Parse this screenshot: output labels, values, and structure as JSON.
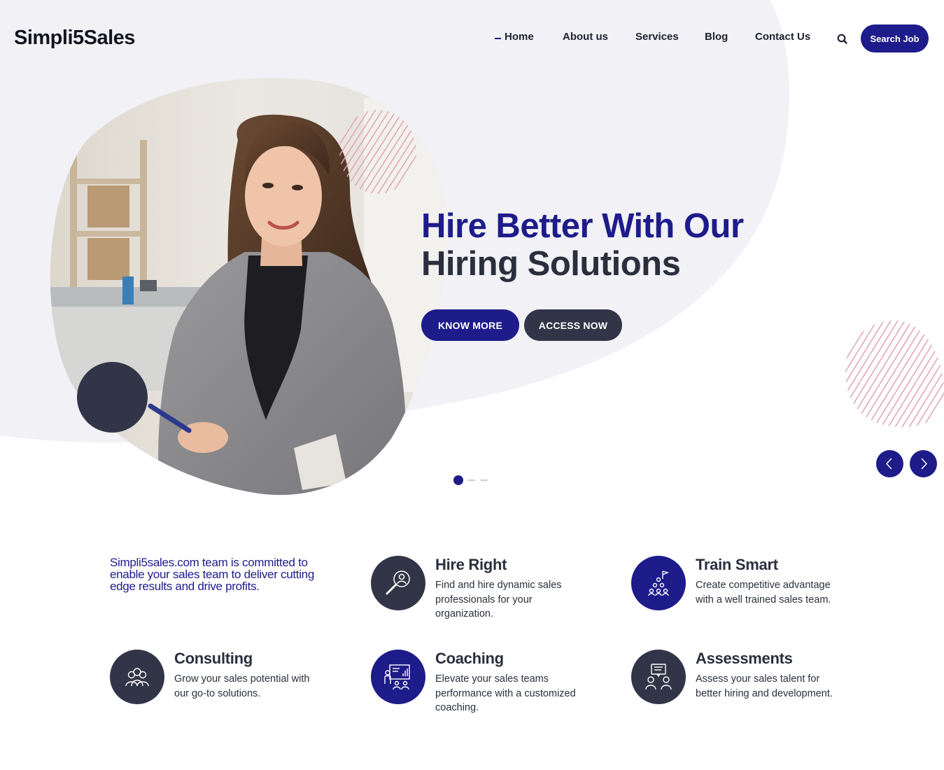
{
  "header": {
    "logo": "Simpli5Sales",
    "nav": [
      {
        "label": "Home",
        "active": true
      },
      {
        "label": "About us",
        "active": false
      },
      {
        "label": "Services",
        "active": false
      },
      {
        "label": "Blog",
        "active": false
      },
      {
        "label": "Contact Us",
        "active": false
      }
    ],
    "search_icon": "search-icon",
    "cta_label": "Search Job"
  },
  "hero": {
    "title_line1": "Hire Better With Our",
    "title_line2": "Hiring Solutions",
    "primary_button": "KNOW MORE",
    "secondary_button": "ACCESS NOW",
    "slider": {
      "current_slide": 1,
      "total_slides": 3
    },
    "prev_icon": "chevron-left-icon",
    "next_icon": "chevron-right-icon"
  },
  "features": {
    "intro": "Simpli5sales.com team is committed to enable your sales team to deliver cutting edge results and drive profits.",
    "items": [
      {
        "title": "Hire Right",
        "text": "Find and hire dynamic sales professionals for your organization.",
        "icon": "magnifier-person-icon",
        "style": "dark"
      },
      {
        "title": "Train Smart",
        "text": "Create competitive advantage with a well trained sales team.",
        "icon": "team-pyramid-flag-icon",
        "style": "blue"
      },
      {
        "title": "Consulting",
        "text": "Grow your sales potential with our go-to solutions.",
        "icon": "group-people-icon",
        "style": "dark"
      },
      {
        "title": "Coaching",
        "text": "Elevate your sales teams performance with a customized coaching.",
        "icon": "presentation-board-icon",
        "style": "blue"
      },
      {
        "title": "Assessments",
        "text": "Assess your sales talent for better hiring and development.",
        "icon": "discussion-people-icon",
        "style": "dark"
      }
    ]
  },
  "colors": {
    "primary": "#1e1b8a",
    "dark": "#323547",
    "background_blob": "#f1f1f6",
    "hatch": "#e2a4ae"
  }
}
